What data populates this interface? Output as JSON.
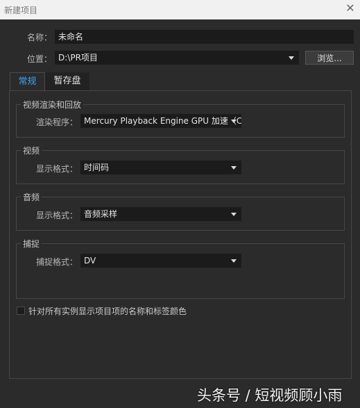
{
  "window": {
    "title": "新建项目",
    "close_glyph": "✕"
  },
  "form": {
    "name_label": "名称：",
    "name_value": "未命名",
    "location_label": "位置：",
    "location_value": "D:\\PR项目",
    "browse_label": "浏览..."
  },
  "tabs": [
    {
      "label": "常规",
      "active": true
    },
    {
      "label": "暂存盘",
      "active": false
    }
  ],
  "groups": {
    "render": {
      "legend": "视频渲染和回放",
      "label": "渲染程序：",
      "value": "Mercury Playback Engine GPU 加速（CUDA"
    },
    "video": {
      "legend": "视频",
      "label": "显示格式：",
      "value": "时间码"
    },
    "audio": {
      "legend": "音频",
      "label": "显示格式：",
      "value": "音频采样"
    },
    "capture": {
      "legend": "捕捉",
      "label": "捕捉格式：",
      "value": "DV"
    }
  },
  "checkbox": {
    "label": "针对所有实例显示项目项的名称和标签颜色",
    "checked": false
  },
  "watermark": "头条号 / 短视频顾小雨",
  "colors": {
    "background": "#2b2b2b",
    "field": "#1b1b1b",
    "tab_active_text": "#3fa3f0",
    "border": "#474747"
  }
}
